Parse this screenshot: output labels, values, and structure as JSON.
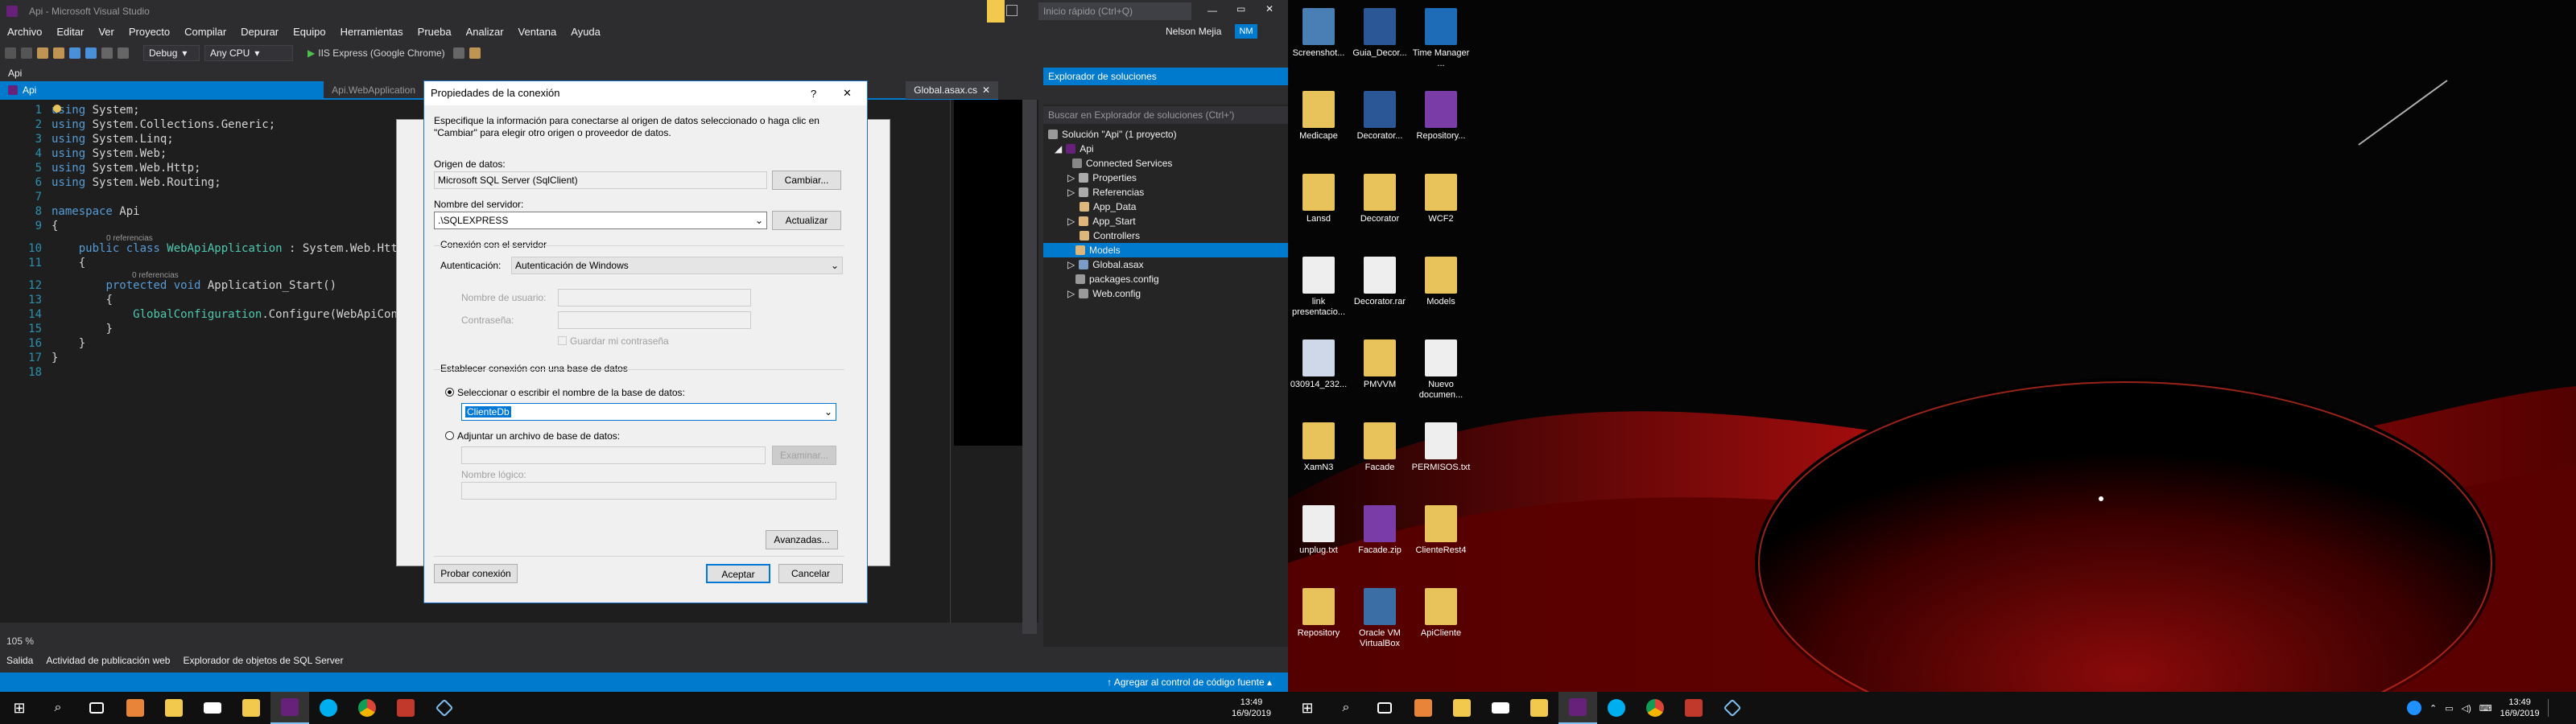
{
  "vs": {
    "window_title": "Api - Microsoft Visual Studio",
    "quick_launch": "Inicio rápido (Ctrl+Q)",
    "user_name": "Nelson Mejia",
    "user_initials": "NM",
    "menu": [
      "Archivo",
      "Editar",
      "Ver",
      "Proyecto",
      "Compilar",
      "Depurar",
      "Equipo",
      "Herramientas",
      "Prueba",
      "Analizar",
      "Ventana",
      "Ayuda"
    ],
    "toolbar": {
      "config": "Debug",
      "platform": "Any CPU",
      "run": "IIS Express (Google Chrome)"
    },
    "file_bar": "Api",
    "tabs": [
      "Api",
      "Api.WebApplication",
      "Global.asax.cs"
    ],
    "code": {
      "numbers": [
        "1",
        "2",
        "3",
        "4",
        "5",
        "6",
        "7",
        "8",
        "9",
        "10",
        "11",
        "12",
        "13",
        "14",
        "15",
        "16",
        "17",
        "18"
      ],
      "refs": [
        "0 referencias",
        "0 referencias"
      ],
      "l1": "System;",
      "l2": "System.Collections.Generic;",
      "l3": "System.Linq;",
      "l4": "System.Web;",
      "l5": "System.Web.Http;",
      "l6": "System.Web.Routing;",
      "kw_using": "using",
      "ns_kw": "namespace",
      "ns_name": " Api",
      "class_line_kw": "public class ",
      "class_name": "WebApiApplication",
      " class_rest": " : System.Web.Http",
      "method_kw": "protected void ",
      "method_name": "Application_Start()",
      "call": "GlobalConfiguration",
      "call_rest": ".Configure(WebApiConf",
      "brace_open": "{",
      "brace_close": "}"
    },
    "zoom": "105 %",
    "bottom_tabs": [
      "Salida",
      "Actividad de publicación web",
      "Explorador de objetos de SQL Server"
    ],
    "status": "↑ Agregar al control de código fuente ▴"
  },
  "solution_explorer": {
    "title": "Explorador de soluciones",
    "search": "Buscar en Explorador de soluciones (Ctrl+')",
    "items": [
      {
        "label": "Solución \"Api\" (1 proyecto)"
      },
      {
        "label": "Api"
      },
      {
        "label": "Connected Services"
      },
      {
        "label": "Properties"
      },
      {
        "label": "Referencias"
      },
      {
        "label": "App_Data"
      },
      {
        "label": "App_Start"
      },
      {
        "label": "Controllers"
      },
      {
        "label": "Models"
      },
      {
        "label": "Global.asax"
      },
      {
        "label": "packages.config"
      },
      {
        "label": "Web.config"
      }
    ]
  },
  "dialog": {
    "title": "Propiedades de la conexión",
    "help": "?",
    "close": "✕",
    "intro": "Especifique la información para conectarse al origen de datos seleccionado o haga clic en \"Cambiar\" para elegir otro origen o proveedor de datos.",
    "datasource_label": "Origen de datos:",
    "datasource_value": "Microsoft SQL Server (SqlClient)",
    "change_btn": "Cambiar...",
    "server_label": "Nombre del servidor:",
    "server_value": ".\\SQLEXPRESS",
    "refresh_btn": "Actualizar",
    "logon_group": "Conexión con el servidor",
    "auth_label": "Autenticación:",
    "auth_value": "Autenticación de Windows",
    "user_label": "Nombre de usuario:",
    "pass_label": "Contraseña:",
    "save_pass": "Guardar mi contraseña",
    "db_group": "Establecer conexión con una base de datos",
    "select_db_label": "Seleccionar o escribir el nombre de la base de datos:",
    "db_value": "ClienteDb",
    "attach_label": "Adjuntar un archivo de base de datos:",
    "browse_btn": "Examinar...",
    "logical_label": "Nombre lógico:",
    "advanced_btn": "Avanzadas...",
    "test_btn": "Probar conexión",
    "ok_btn": "Aceptar",
    "cancel_btn": "Cancelar"
  },
  "desktop": {
    "icons": [
      {
        "label": "Screenshot...",
        "color": "#4a7fb5"
      },
      {
        "label": "Guia_Decor...",
        "color": "#2b5797"
      },
      {
        "label": "Time Manager ...",
        "color": "#1e6bb8"
      },
      {
        "label": "Medicape",
        "color": "#e8c25a"
      },
      {
        "label": "Decorator...",
        "color": "#2b5797"
      },
      {
        "label": "Repository...",
        "color": "#7a3da8"
      },
      {
        "label": "Lansd",
        "color": "#e8c25a"
      },
      {
        "label": "Decorator",
        "color": "#e8c25a"
      },
      {
        "label": "WCF2",
        "color": "#e8c25a"
      },
      {
        "label": "link presentacio...",
        "color": "#eeeeee"
      },
      {
        "label": "Decorator.rar",
        "color": "#eeeeee"
      },
      {
        "label": "Models",
        "color": "#e8c25a"
      },
      {
        "label": "030914_232...",
        "color": "#cfd8e8"
      },
      {
        "label": "PMVVM",
        "color": "#e8c25a"
      },
      {
        "label": "Nuevo documen...",
        "color": "#eeeeee"
      },
      {
        "label": "XamN3",
        "color": "#e8c25a"
      },
      {
        "label": "Facade",
        "color": "#e8c25a"
      },
      {
        "label": "PERMISOS.txt",
        "color": "#eeeeee"
      },
      {
        "label": "unplug.txt",
        "color": "#eeeeee"
      },
      {
        "label": "Facade.zip",
        "color": "#7a3da8"
      },
      {
        "label": "ClienteRest4",
        "color": "#e8c25a"
      },
      {
        "label": "Repository",
        "color": "#e8c25a"
      },
      {
        "label": "Oracle VM VirtualBox",
        "color": "#3a6ea5"
      },
      {
        "label": "ApiCliente",
        "color": "#e8c25a"
      }
    ]
  },
  "taskbar": {
    "time": "13:49",
    "date": "16/9/2019",
    "apps_left": [
      "windows",
      "search",
      "taskview",
      "explorer-orange",
      "explorer",
      "mail",
      "store",
      "visualstudio",
      "skype",
      "chrome",
      "filezilla",
      "vscode"
    ],
    "colors": {
      "vs": "#68217a",
      "accent": "#007acc"
    }
  }
}
